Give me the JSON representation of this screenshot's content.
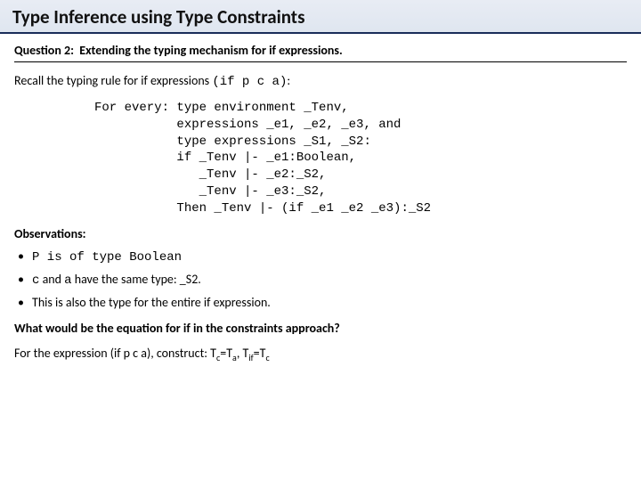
{
  "header": {
    "title": "Type Inference using Type Constraints"
  },
  "question": {
    "label": "Question 2:",
    "text": "Extending the typing mechanism for if expressions."
  },
  "recall": {
    "prefix": "Recall the typing rule for if expressions ",
    "code": "(if p c a)",
    "suffix": ":"
  },
  "rule": "For every: type environment _Tenv,\n           expressions _e1, _e2, _e3, and\n           type expressions _S1, _S2:\n           if _Tenv |- _e1:Boolean,\n              _Tenv |- _e2:_S2,\n              _Tenv |- _e3:_S2,\n           Then _Tenv |- (if _e1 _e2 _e3):_S2",
  "observations": {
    "heading": "Observations:",
    "items": {
      "0": {
        "code": "P is of type Boolean"
      },
      "1": {
        "c": "c",
        "mid": " and ",
        "a": "a",
        "tail": " have the same type: _S2."
      },
      "2": {
        "text": "This is also the type for the entire if expression."
      }
    }
  },
  "closing": {
    "q": "What would be the equation for if in the constraints approach?",
    "expr_prefix": "For the expression (if p c a),  construct: T",
    "sub1": "c",
    "eq1": "=T",
    "sub2": "a",
    "sep": ", T",
    "sub3": "if",
    "eq2": "=T",
    "sub4": "c"
  }
}
